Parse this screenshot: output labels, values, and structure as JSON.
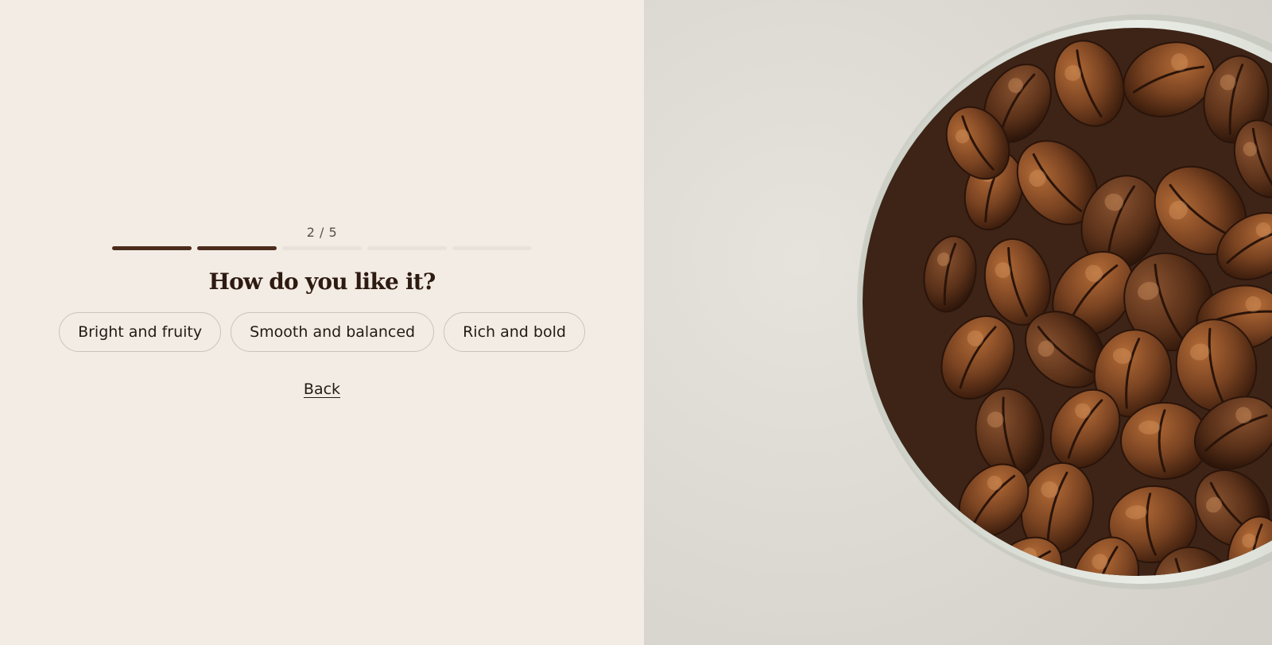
{
  "quiz": {
    "step_label": "2 / 5",
    "current_step": 2,
    "total_steps": 5,
    "question": "How do you like it?",
    "options": [
      "Bright and fruity",
      "Smooth and balanced",
      "Rich and bold"
    ],
    "back_label": "Back"
  },
  "colors": {
    "background": "#f3ece5",
    "progress_done": "#4a2c1d",
    "progress_todo": "#e8e2db",
    "heading": "#2d1a10"
  },
  "hero_image": {
    "icon": "coffee-beans-in-cup-photo"
  }
}
